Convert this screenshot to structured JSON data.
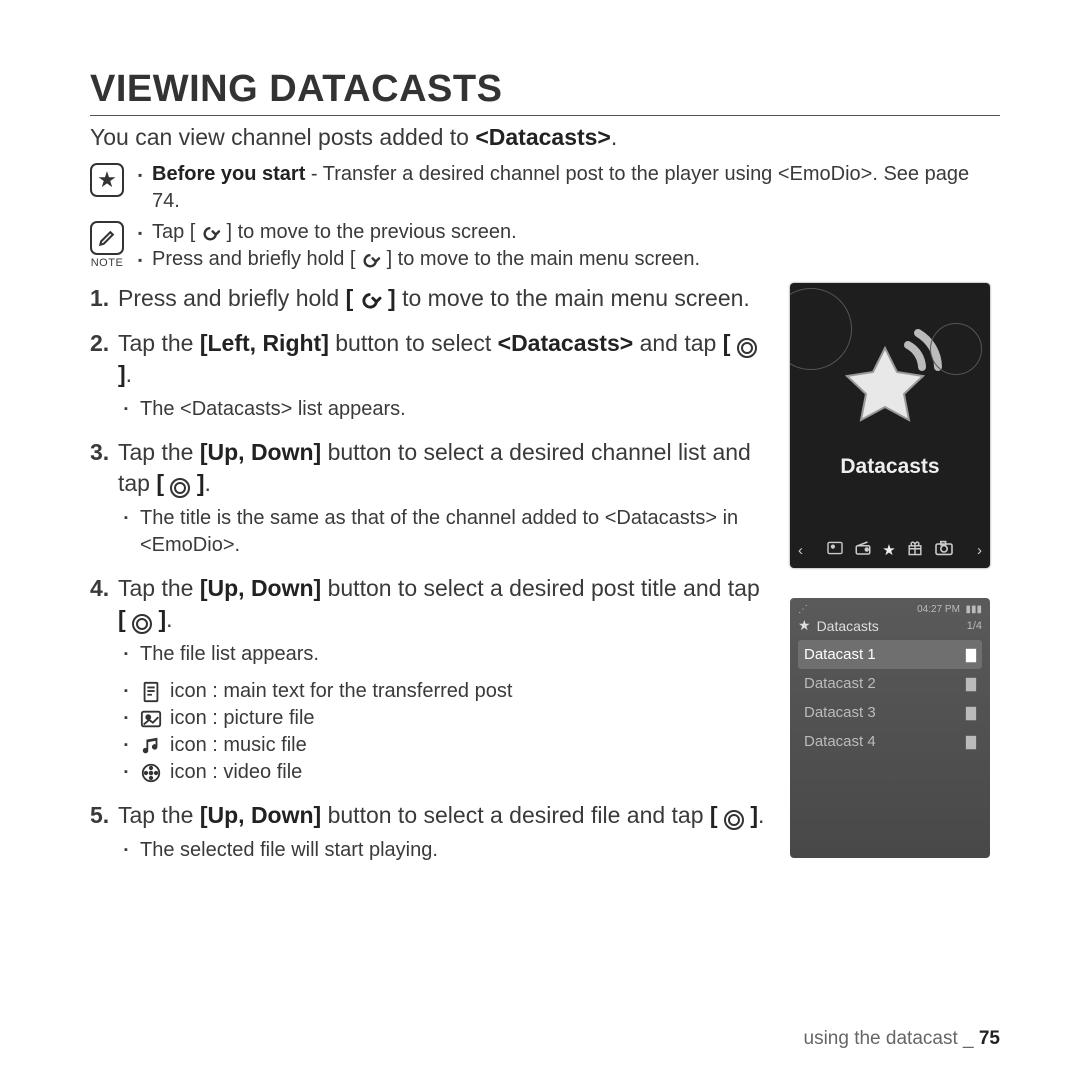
{
  "title": "VIEWING DATACASTS",
  "intro_pre": "You can view channel posts added to ",
  "intro_bold": "<Datacasts>",
  "intro_post": ".",
  "before_start_label": "Before you start",
  "before_start_text": " - Transfer a desired channel post to the player using <EmoDio>. See page 74.",
  "note_label": "NOTE",
  "note_line1_a": "Tap [ ",
  "note_line1_b": " ] to move to the previous screen.",
  "note_line2_a": "Press and briefly hold [ ",
  "note_line2_b": " ] to move to the main menu screen.",
  "steps": {
    "s1_a": "Press and briefly hold ",
    "s1_b_pre": "[ ",
    "s1_b_post": " ]",
    "s1_c": " to move to the main menu screen.",
    "s2_a": "Tap the ",
    "s2_bold": "[Left, Right]",
    "s2_b": " button to select ",
    "s2_boldb": "<Datacasts>",
    "s2_c": " and tap ",
    "s2_sub": "The <Datacasts> list appears.",
    "s3_a": "Tap the ",
    "s3_bold": "[Up, Down]",
    "s3_b": " button to select a desired channel list and tap ",
    "s3_sub": "The title is the same as that of the channel added to <Datacasts> in <EmoDio>.",
    "s4_a": "Tap the ",
    "s4_bold": "[Up, Down]",
    "s4_b": " button to select a desired post title and tap ",
    "s4_sub": "The file list appears.",
    "icon_text": " icon : main text for the transferred post",
    "icon_pic": " icon : picture file",
    "icon_music": " icon : music file",
    "icon_video": " icon : video file",
    "s5_a": "Tap the ",
    "s5_bold": "[Up, Down]",
    "s5_b": " button to select a desired file and tap ",
    "s5_sub": "The selected file will start playing."
  },
  "device1_label": "Datacasts",
  "device2": {
    "time": "04:27 PM",
    "title": "Datacasts",
    "count": "1/4",
    "items": [
      "Datacast 1",
      "Datacast 2",
      "Datacast 3",
      "Datacast 4"
    ]
  },
  "footer_a": "using the datacast _ ",
  "footer_b": "75"
}
